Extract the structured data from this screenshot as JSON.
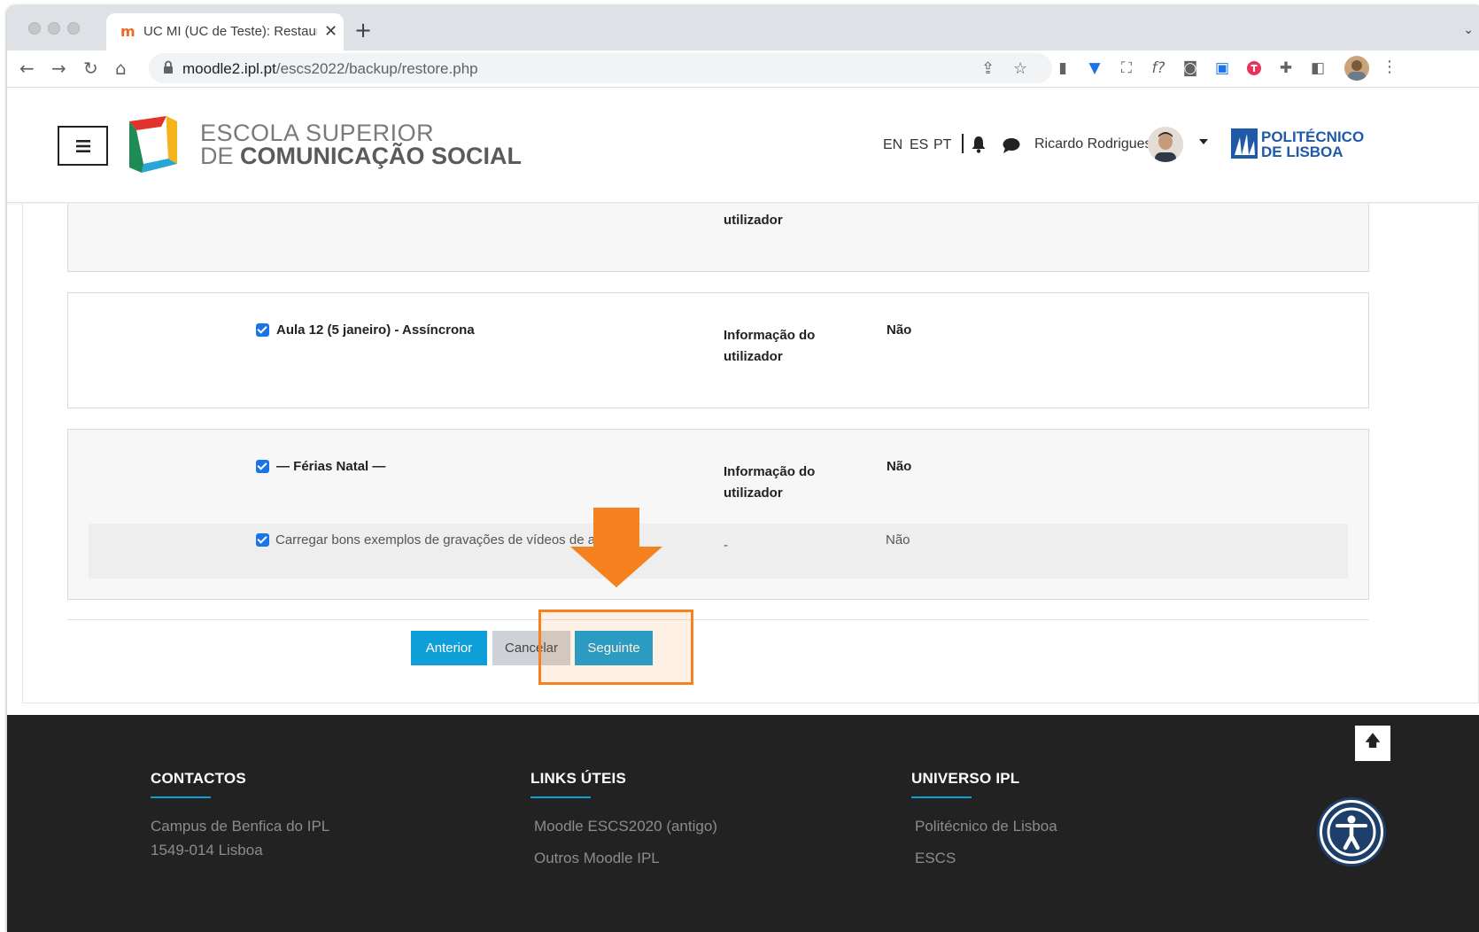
{
  "browser": {
    "tab_title": "UC MI (UC de Teste): Restaurar",
    "tab_close": "✕",
    "new_tab": "+",
    "url_host": "moodle2.ipl.pt",
    "url_path": "/escs2022/backup/restore.php",
    "icons": [
      "back-icon",
      "forward-icon",
      "reload-icon",
      "home-icon",
      "share-icon",
      "star-icon",
      "extensions-icon"
    ]
  },
  "header": {
    "logo_line1": "ESCOLA SUPERIOR",
    "logo_line2_prefix": "DE ",
    "logo_line2_bold": "COMUNICAÇÃO SOCIAL",
    "languages": [
      "EN",
      "ES",
      "PT"
    ],
    "username": "Ricardo Rodrigues",
    "partner_line1": "POLITÉCNICO",
    "partner_line2": "DE LISBOA"
  },
  "sections": [
    {
      "col2_line1": "utilizador"
    },
    {
      "title": "Aula 12 (5 janeiro) - Assíncrona",
      "col2_line1": "Informação do",
      "col2_line2": "utilizador",
      "col3": "Não",
      "checked": true
    },
    {
      "title": "— Férias Natal —",
      "col2_line1": "Informação do",
      "col2_line2": "utilizador",
      "col3": "Não",
      "checked": true,
      "activity": {
        "title": "Carregar bons exemplos de gravações de vídeos de a...",
        "col2": "-",
        "col3": "Não",
        "checked": true
      }
    }
  ],
  "buttons": {
    "previous": "Anterior",
    "cancel": "Cancelar",
    "next": "Seguinte"
  },
  "annotation": {
    "color": "#f5821f"
  },
  "footer": {
    "contacts": {
      "heading": "CONTACTOS",
      "line1": "Campus de Benfica do IPL",
      "line2": "1549-014 Lisboa"
    },
    "links": {
      "heading": "LINKS ÚTEIS",
      "items": [
        "Moodle ESCS2020 (antigo)",
        "Outros Moodle IPL"
      ]
    },
    "universe": {
      "heading": "UNIVERSO IPL",
      "items": [
        "Politécnico de Lisboa",
        "ESCS"
      ]
    }
  },
  "colors": {
    "primary_button": "#0f9fd8",
    "footer_bg": "#222222",
    "highlight": "#f5821f"
  }
}
